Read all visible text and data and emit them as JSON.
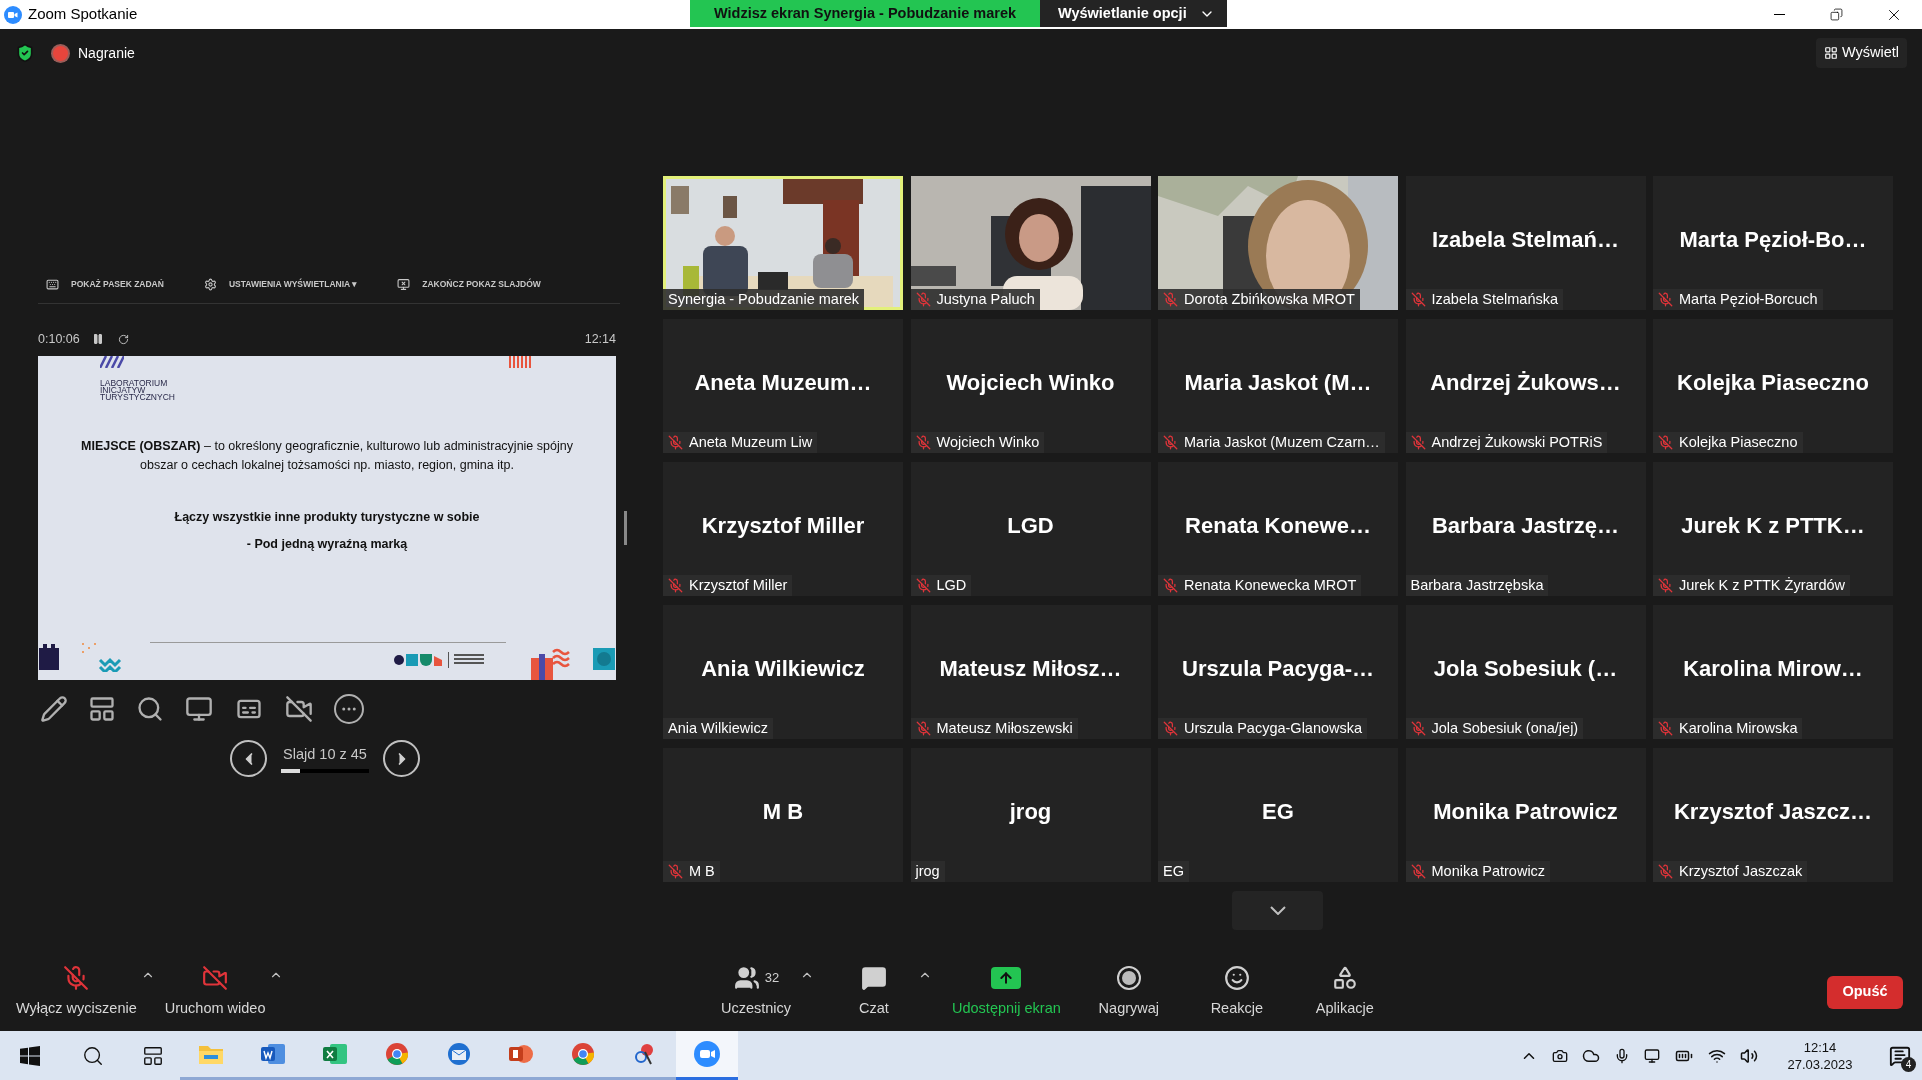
{
  "window": {
    "title": "Zoom Spotkanie"
  },
  "share_banner": {
    "text": "Widzisz ekran Synergia - Pobudzanie marek",
    "options_button": "Wyświetlanie opcji"
  },
  "top_bar": {
    "recording_label": "Nagranie",
    "view_button": "Wyświetl"
  },
  "presenter": {
    "toolbar": [
      {
        "kind": "taskbar",
        "label": "POKAŻ PASEK ZADAŃ"
      },
      {
        "kind": "settings",
        "label": "USTAWIENIA WYŚWIETLANIA ▾"
      },
      {
        "kind": "end",
        "label": "ZAKOŃCZ POKAZ SLAJDÓW"
      }
    ],
    "elapsed": "0:10:06",
    "clock": "12:14",
    "slide": {
      "logo_lines": [
        "LABORATORIUM",
        "INICJATYW",
        "TURYSTYCZNYCH"
      ],
      "paragraph": "**MIEJSCE (OBSZAR)** – to określony geograficznie, kulturowo lub administracyjnie spójny obszar o cechach lokalnej tożsamości np. miasto, region, gmina itp.",
      "line_1": "Łączy wszystkie inne produkty turystyczne w sobie",
      "line_2": "- Pod jedną wyraźną marką"
    },
    "slide_counter": "Slajd 10 z 45",
    "level": 0.22
  },
  "tiles": [
    {
      "kind": "video",
      "label": "Synergia - Pobudzanie marek",
      "muted": false,
      "selected": true
    },
    {
      "kind": "video",
      "label": "Justyna Paluch",
      "muted": true,
      "selected": false
    },
    {
      "kind": "video",
      "label": "Dorota Zbińkowska MROT",
      "muted": true,
      "selected": false
    },
    {
      "kind": "name",
      "display_name": "Izabela Stelmań…",
      "label": "Izabela Stelmańska",
      "muted": true,
      "selected": false
    },
    {
      "kind": "name",
      "display_name": "Marta Pęzioł-Bo…",
      "label": "Marta Pęzioł-Borcuch",
      "muted": true,
      "selected": false
    },
    {
      "kind": "name",
      "display_name": "Aneta Muzeum…",
      "label": "Aneta Muzeum Liw",
      "muted": true,
      "selected": false
    },
    {
      "kind": "name",
      "display_name": "Wojciech Winko",
      "label": "Wojciech Winko",
      "muted": true,
      "selected": false
    },
    {
      "kind": "name",
      "display_name": "Maria Jaskot (M…",
      "label": "Maria Jaskot (Muzem Czarn…",
      "muted": true,
      "selected": false
    },
    {
      "kind": "name",
      "display_name": "Andrzej Żukows…",
      "label": "Andrzej Żukowski POTRiS",
      "muted": true,
      "selected": false
    },
    {
      "kind": "name",
      "display_name": "Kolejka Piaseczno",
      "label": "Kolejka Piaseczno",
      "muted": true,
      "selected": false
    },
    {
      "kind": "name",
      "display_name": "Krzysztof Miller",
      "label": "Krzysztof Miller",
      "muted": true,
      "selected": false
    },
    {
      "kind": "name",
      "display_name": "LGD",
      "label": "LGD",
      "muted": true,
      "selected": false
    },
    {
      "kind": "name",
      "display_name": "Renata Konewe…",
      "label": "Renata Konewecka MROT",
      "muted": true,
      "selected": false
    },
    {
      "kind": "name",
      "display_name": "Barbara Jastrzę…",
      "label": "Barbara Jastrzębska",
      "muted": false,
      "selected": false
    },
    {
      "kind": "name",
      "display_name": "Jurek K z PTTK…",
      "label": "Jurek K z PTTK Żyrardów",
      "muted": true,
      "selected": false
    },
    {
      "kind": "name",
      "display_name": "Ania Wilkiewicz",
      "label": "Ania Wilkiewicz",
      "muted": false,
      "selected": false
    },
    {
      "kind": "name",
      "display_name": "Mateusz Miłosz…",
      "label": "Mateusz Miłoszewski",
      "muted": true,
      "selected": false
    },
    {
      "kind": "name",
      "display_name": "Urszula Pacyga-…",
      "label": "Urszula Pacyga-Glanowska",
      "muted": true,
      "selected": false
    },
    {
      "kind": "name",
      "display_name": "Jola Sobesiuk (…",
      "label": "Jola Sobesiuk (ona/jej)",
      "muted": true,
      "selected": false
    },
    {
      "kind": "name",
      "display_name": "Karolina Mirow…",
      "label": "Karolina Mirowska",
      "muted": true,
      "selected": false
    },
    {
      "kind": "name",
      "display_name": "M B",
      "label": "M B",
      "muted": true,
      "selected": false
    },
    {
      "kind": "name",
      "display_name": "jrog",
      "label": "jrog",
      "muted": false,
      "selected": false
    },
    {
      "kind": "name",
      "display_name": "EG",
      "label": "EG",
      "muted": false,
      "selected": false
    },
    {
      "kind": "name",
      "display_name": "Monika Patrowicz",
      "label": "Monika Patrowicz",
      "muted": true,
      "selected": false
    },
    {
      "kind": "name",
      "display_name": "Krzysztof Jaszcz…",
      "label": "Krzysztof Jaszczak",
      "muted": true,
      "selected": false
    }
  ],
  "meeting_toolbar": [
    {
      "kind": "mic",
      "label": "Wyłącz wyciszenie",
      "caret": true
    },
    {
      "kind": "video",
      "label": "Uruchom wideo",
      "caret": true
    },
    {
      "kind": "participants",
      "label": "Uczestnicy",
      "count": "32",
      "caret": true
    },
    {
      "kind": "chat",
      "label": "Czat",
      "caret": true
    },
    {
      "kind": "share",
      "label": "Udostępnij ekran",
      "caret": false
    },
    {
      "kind": "record",
      "label": "Nagrywaj",
      "caret": false
    },
    {
      "kind": "reactions",
      "label": "Reakcje",
      "caret": false
    },
    {
      "kind": "apps",
      "label": "Aplikacje",
      "caret": false
    }
  ],
  "leave_button": "Opuść",
  "taskbar": {
    "apps": [
      {
        "kind": "folder",
        "selected": false
      },
      {
        "kind": "doc",
        "selected": false
      },
      {
        "kind": "sheet",
        "selected": false
      },
      {
        "kind": "browser",
        "selected": false
      },
      {
        "kind": "mail",
        "selected": false
      },
      {
        "kind": "slides",
        "selected": false
      },
      {
        "kind": "browser",
        "selected": false
      },
      {
        "kind": "paint",
        "selected": false
      },
      {
        "kind": "meeting",
        "selected": true
      }
    ],
    "time": "12:14",
    "date": "27.03.2023",
    "notifications": "4"
  }
}
